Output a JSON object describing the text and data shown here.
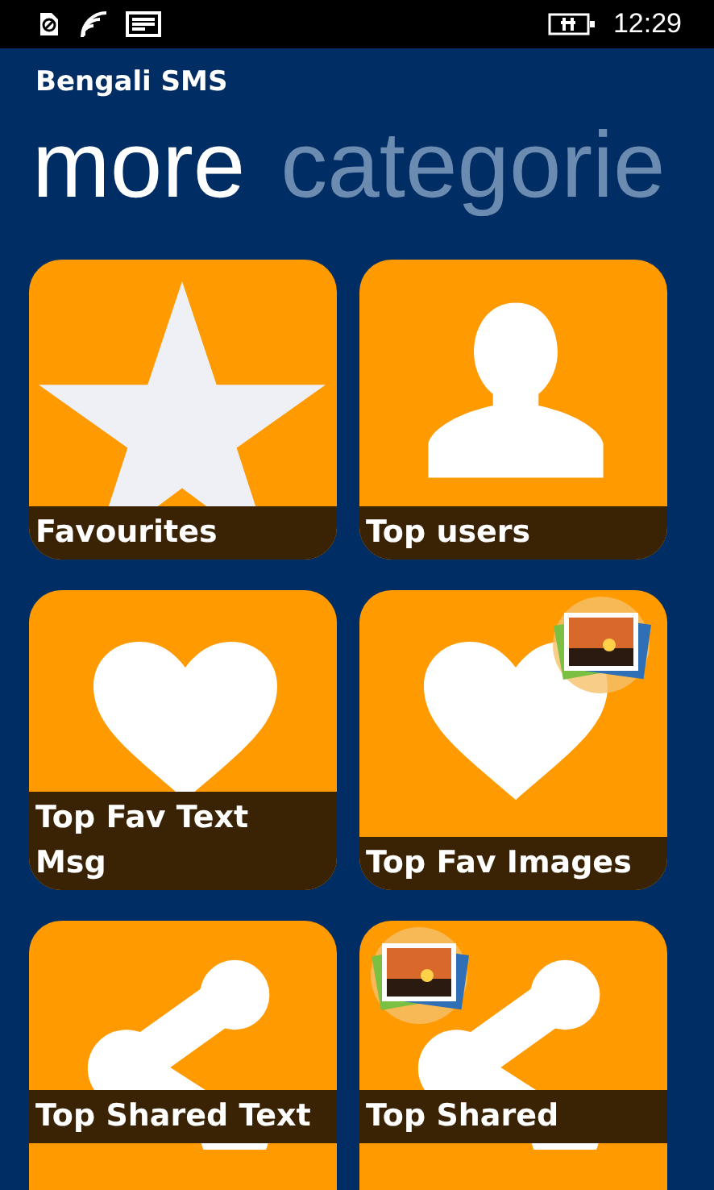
{
  "status_bar": {
    "time": "12:29"
  },
  "app_title": "Bengali SMS",
  "pivot": [
    {
      "label": "more",
      "selected": true
    },
    {
      "label": "categorie",
      "selected": false
    }
  ],
  "tiles": [
    {
      "label": "Favourites",
      "kind": "star",
      "photo_badge": false
    },
    {
      "label": "Top users",
      "kind": "person",
      "photo_badge": false
    },
    {
      "label": "Top Fav Text Msg",
      "kind": "heart",
      "photo_badge": false
    },
    {
      "label": "Top Fav Images",
      "kind": "heart",
      "photo_badge": true
    },
    {
      "label": "Top Shared Text",
      "kind": "share",
      "photo_badge": false
    },
    {
      "label": "Top Shared",
      "kind": "share",
      "photo_badge": true
    }
  ]
}
